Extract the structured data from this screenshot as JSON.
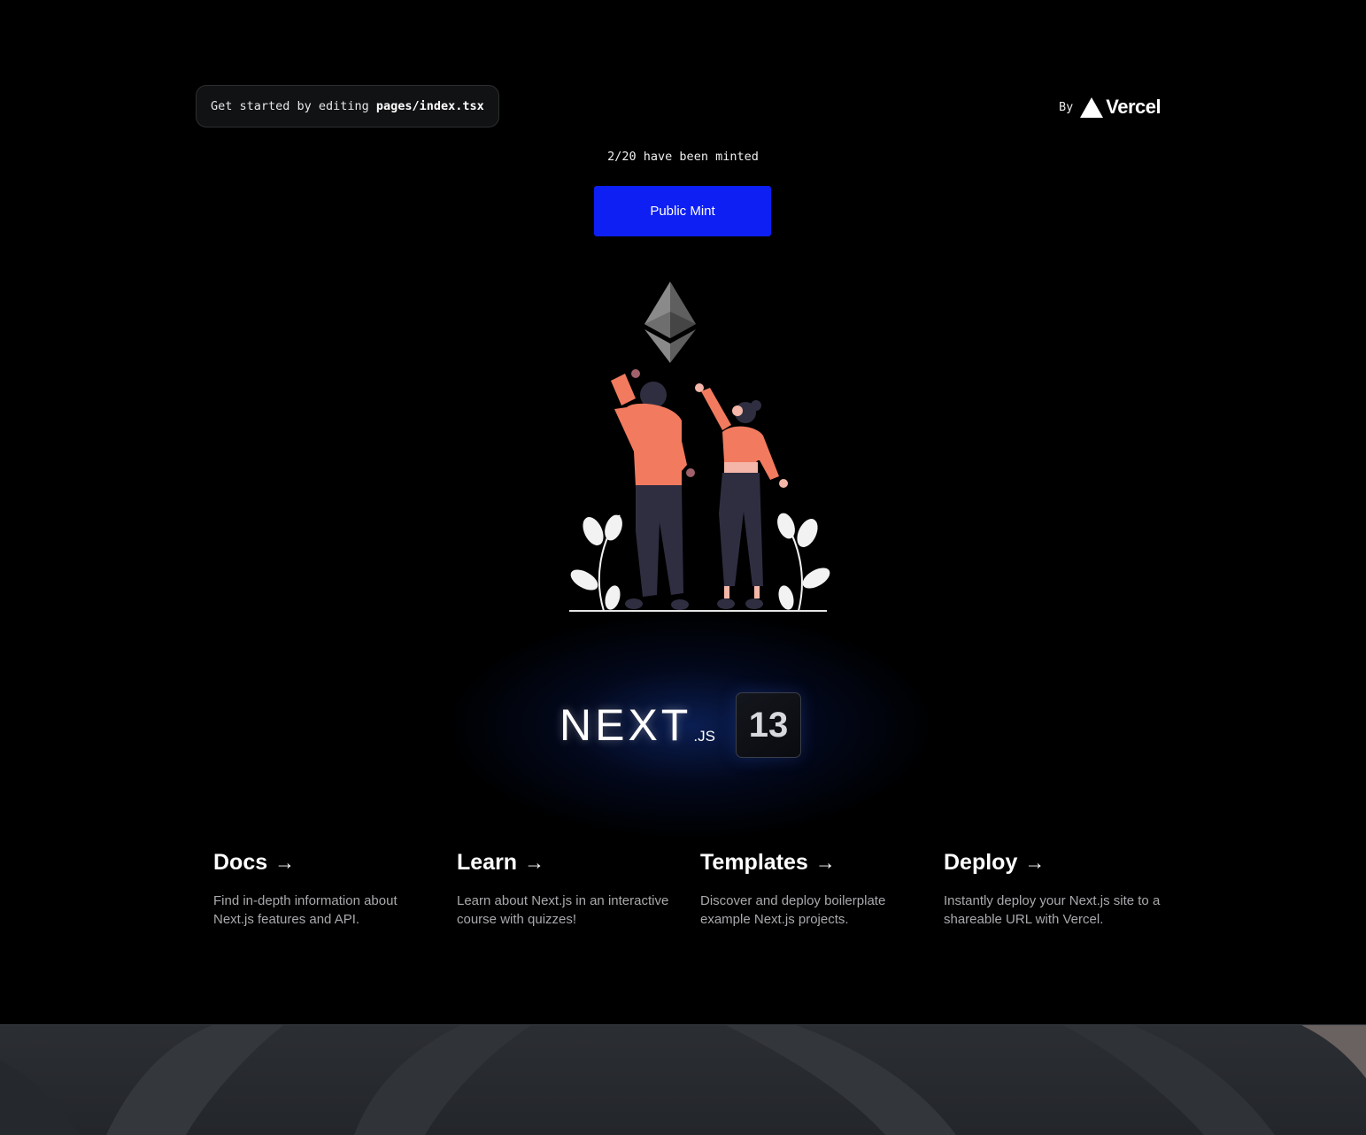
{
  "header": {
    "hint_prefix": "Get started by editing",
    "hint_file": "pages/index.tsx",
    "by_label": "By",
    "vercel_label": "Vercel"
  },
  "mint": {
    "status": "2/20 have been minted",
    "button_label": "Public Mint"
  },
  "hero": {
    "logo_word": "NEXT",
    "logo_suffix": ".JS",
    "version": "13"
  },
  "cards": [
    {
      "title": "Docs",
      "arrow": "→",
      "description": "Find in-depth information about Next.js features and API."
    },
    {
      "title": "Learn",
      "arrow": "→",
      "description": "Learn about Next.js in an interactive course with quizzes!"
    },
    {
      "title": "Templates",
      "arrow": "→",
      "description": "Discover and deploy boilerplate example Next.js projects."
    },
    {
      "title": "Deploy",
      "arrow": "→",
      "description": "Instantly deploy your Next.js site to a shareable URL with Vercel."
    }
  ],
  "colors": {
    "background": "#000000",
    "mint_button": "#0d1ff2",
    "figure_shirt": "#f27a5e",
    "figure_pants": "#2f2e41",
    "desktop": "#2a2d31"
  },
  "icons": [
    "vercel-triangle-icon",
    "ethereum-icon",
    "arrow-right-icon"
  ]
}
